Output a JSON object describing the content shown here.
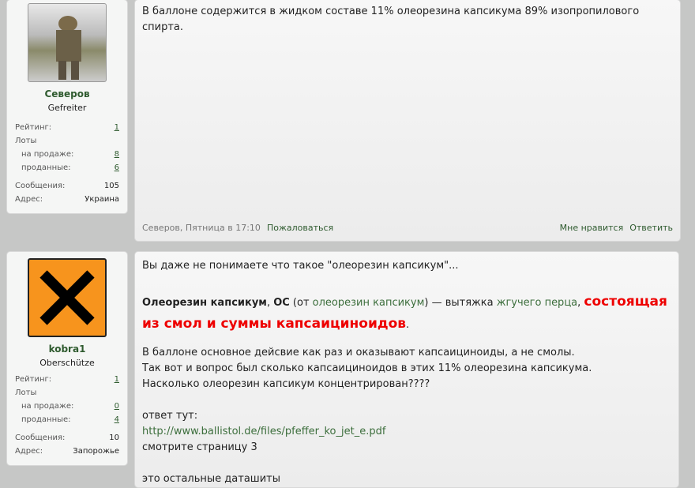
{
  "posts": [
    {
      "user": {
        "name": "Северов",
        "rank": "Gefreiter",
        "rating_label": "Рейтинг:",
        "rating": "1",
        "lots_label": "Лоты",
        "on_sale_label": "на продаже:",
        "on_sale": "8",
        "sold_label": "проданные:",
        "sold": "6",
        "messages_label": "Сообщения:",
        "messages": "105",
        "address_label": "Адрес:",
        "address": "Украина"
      },
      "text": "В баллоне содержится в жидком составе 11% олеорезина капсикума 89% изопропилового спирта.",
      "meta": "Северов, Пятница в 17:10",
      "report": "Пожаловаться",
      "like": "Мне нравится",
      "reply": "Ответить"
    },
    {
      "user": {
        "name": "kobra1",
        "rank": "Oberschütze",
        "rating_label": "Рейтинг:",
        "rating": "1",
        "lots_label": "Лоты",
        "on_sale_label": "на продаже:",
        "on_sale": "0",
        "sold_label": "проданные:",
        "sold": "4",
        "messages_label": "Сообщения:",
        "messages": "10",
        "address_label": "Адрес:",
        "address": "Запорожье"
      },
      "p1": "Вы даже не понимаете что такое \"олеорезин капсикум\"...",
      "def_bold": "Олеорезин капсикум",
      "def_comma": ", ",
      "def_os": "ОС",
      "def_from": " (от ",
      "def_link1": "олеорезин капсикум",
      "def_mid": ") — вытяжка ",
      "def_link2": "жгучего перца",
      "def_comma2": ", ",
      "def_red": "состоящая из смол и суммы капсаициноидов",
      "def_end": ".",
      "l1": "В баллоне основное дейсвие как раз и оказывают капсаициноиды, а не смолы.",
      "l2": "Так вот и вопрос был сколько капсаициноидов в этих 11% олеорезина капсикума.",
      "l3": "Насколько олеорезин капсикум концентрирован????",
      "answer": "ответ тут:",
      "url": "http://www.ballistol.de/files/pfeffer_ko_jet_e.pdf",
      "page": "смотрите страницу 3",
      "rest": "это остальные даташиты"
    }
  ]
}
